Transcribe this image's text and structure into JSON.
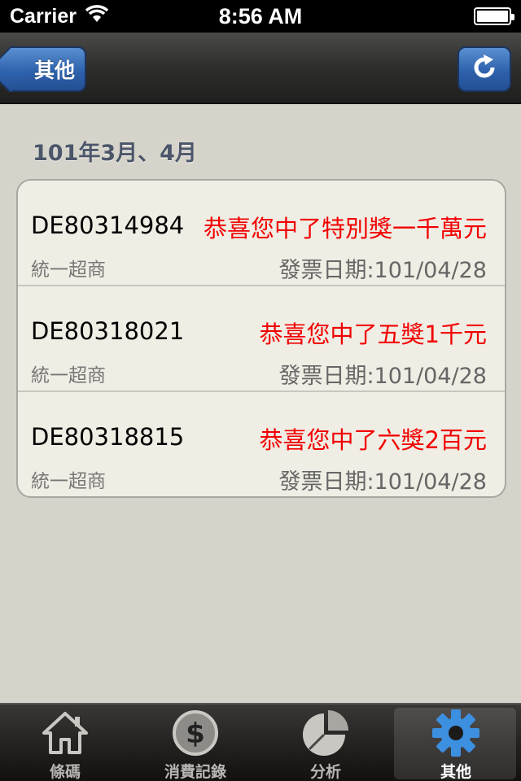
{
  "status_bar": {
    "carrier": "Carrier",
    "time": "8:56 AM"
  },
  "nav_bar": {
    "back_label": "其他"
  },
  "section": {
    "title": "101年3月、4月"
  },
  "rows": [
    {
      "invoice": "DE80314984",
      "prize": "恭喜您中了特別獎一千萬元",
      "store": "統一超商",
      "date": "發票日期:101/04/28"
    },
    {
      "invoice": "DE80318021",
      "prize": "恭喜您中了五獎1千元",
      "store": "統一超商",
      "date": "發票日期:101/04/28"
    },
    {
      "invoice": "DE80318815",
      "prize": "恭喜您中了六獎2百元",
      "store": "統一超商",
      "date": "發票日期:101/04/28"
    }
  ],
  "tabs": [
    {
      "label": "條碼",
      "icon": "home-icon"
    },
    {
      "label": "消費記錄",
      "icon": "dollar-icon"
    },
    {
      "label": "分析",
      "icon": "pie-chart-icon"
    },
    {
      "label": "其他",
      "icon": "gear-icon",
      "selected": true
    }
  ],
  "colors": {
    "prize_text": "#f20000",
    "nav_button": "#2e62ad",
    "selected_tab_icon": "#3d8fe0"
  }
}
